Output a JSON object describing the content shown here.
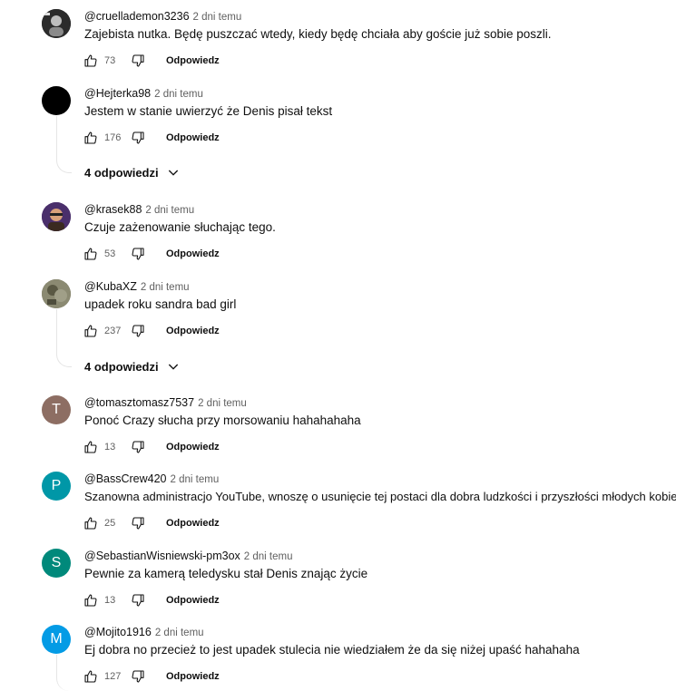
{
  "comments": [
    {
      "author": "@cruellademon3236",
      "time": "2 dni temu",
      "text": "Zajebista nutka. Będę puszczać wtedy, kiedy będę chciała aby goście już sobie poszli.",
      "likes": "73",
      "reply_label": "Odpowiedz",
      "avatar_letter": "",
      "avatar_color": "#2b2b2b"
    },
    {
      "author": "@Hejterka98",
      "time": "2 dni temu",
      "text": "Jestem w stanie uwierzyć że Denis pisał tekst",
      "likes": "176",
      "reply_label": "Odpowiedz",
      "avatar_letter": "",
      "avatar_color": "#000000",
      "replies_label": "4 odpowiedzi"
    },
    {
      "author": "@krasek88",
      "time": "2 dni temu",
      "text": "Czuje zażenowanie słuchając tego.",
      "likes": "53",
      "reply_label": "Odpowiedz",
      "avatar_letter": "",
      "avatar_color": "#4a2f6b"
    },
    {
      "author": "@KubaXZ",
      "time": "2 dni temu",
      "text": "upadek roku sandra bad girl",
      "likes": "237",
      "reply_label": "Odpowiedz",
      "avatar_letter": "",
      "avatar_color": "#6b6a55",
      "replies_label": "4 odpowiedzi"
    },
    {
      "author": "@tomasztomasz7537",
      "time": "2 dni temu",
      "text": "Ponoć Crazy słucha przy morsowaniu hahahahaha",
      "likes": "13",
      "reply_label": "Odpowiedz",
      "avatar_letter": "T",
      "avatar_color": "#8d6e63"
    },
    {
      "author": "@BassCrew420",
      "time": "2 dni temu",
      "text": "Szanowna administracjo YouTube, wnoszę o usunięcie tej postaci dla dobra ludzkości i przyszłości młodych kobiet",
      "likes": "25",
      "reply_label": "Odpowiedz",
      "avatar_letter": "P",
      "avatar_color": "#0097a7"
    },
    {
      "author": "@SebastianWisniewski-pm3ox",
      "time": "2 dni temu",
      "text": "Pewnie za kamerą teledysku stał Denis znając życie",
      "likes": "13",
      "reply_label": "Odpowiedz",
      "avatar_letter": "S",
      "avatar_color": "#00897b"
    },
    {
      "author": "@Mojito1916",
      "time": "2 dni temu",
      "text": "Ej dobra no przecież to jest upadek stulecia nie wiedziałem że da się niżej upaść hahahaha",
      "likes": "127",
      "reply_label": "Odpowiedz",
      "avatar_letter": "M",
      "avatar_color": "#039be5"
    }
  ]
}
